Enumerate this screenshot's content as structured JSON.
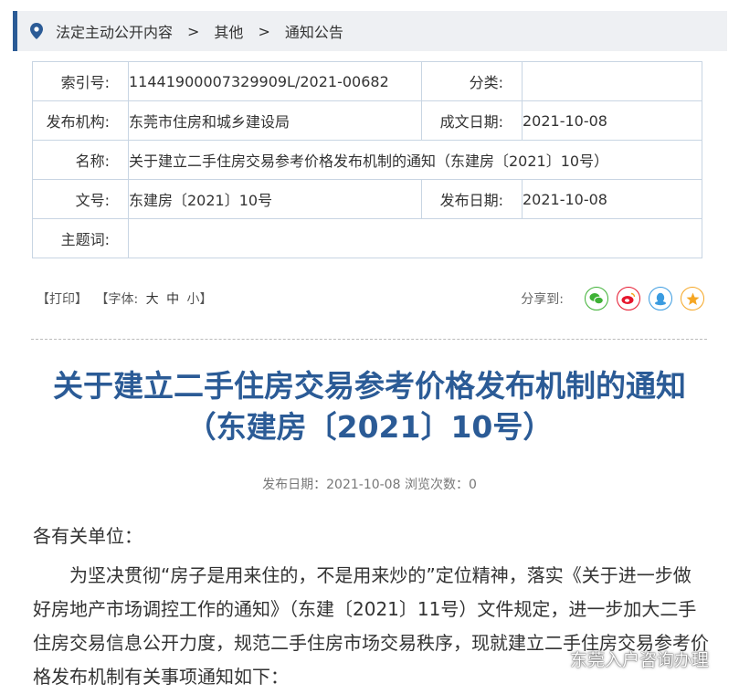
{
  "breadcrumb": {
    "items": [
      "法定主动公开内容",
      "其他",
      "通知公告"
    ],
    "separator": ">"
  },
  "meta": {
    "index_label": "索引号:",
    "index_value": "11441900007329909L/2021-00682",
    "category_label": "分类:",
    "category_value": "",
    "org_label": "发布机构:",
    "org_value": "东莞市住房和城乡建设局",
    "created_label": "成文日期:",
    "created_value": "2021-10-08",
    "name_label": "名称:",
    "name_value": "关于建立二手住房交易参考价格发布机制的通知（东建房〔2021〕10号）",
    "docno_label": "文号:",
    "docno_value": "东建房〔2021〕10号",
    "pub_label": "发布日期:",
    "pub_value": "2021-10-08",
    "subject_label": "主题词:",
    "subject_value": ""
  },
  "tools": {
    "print": "【打印】",
    "font_label": "【字体:",
    "font_large": "大",
    "font_medium": "中",
    "font_small": "小】",
    "share_label": "分享到:"
  },
  "share_icons": [
    "wechat-icon",
    "weibo-icon",
    "qq-icon",
    "qzone-icon"
  ],
  "colors": {
    "accent": "#2b5b96",
    "wechat": "#3eb135",
    "weibo": "#e6162d",
    "qq": "#3a9be0",
    "qzone": "#f5a623"
  },
  "article": {
    "title_line1": "关于建立二手住房交易参考价格发布机制的通知",
    "title_line2": "（东建房〔2021〕10号）",
    "pub_info": "发布日期：2021-10-08  浏览次数：0",
    "salutation": "各有关单位：",
    "paragraph1": "为坚决贯彻“房子是用来住的，不是用来炒的”定位精神，落实《关于进一步做好房地产市场调控工作的通知》（东建〔2021〕11号）文件规定，进一步加大二手住房交易信息公开力度，规范二手住房市场交易秩序，现就建立二手住房交易参考价格发布机制有关事项通知如下："
  },
  "watermark": "东莞入户咨询办理"
}
